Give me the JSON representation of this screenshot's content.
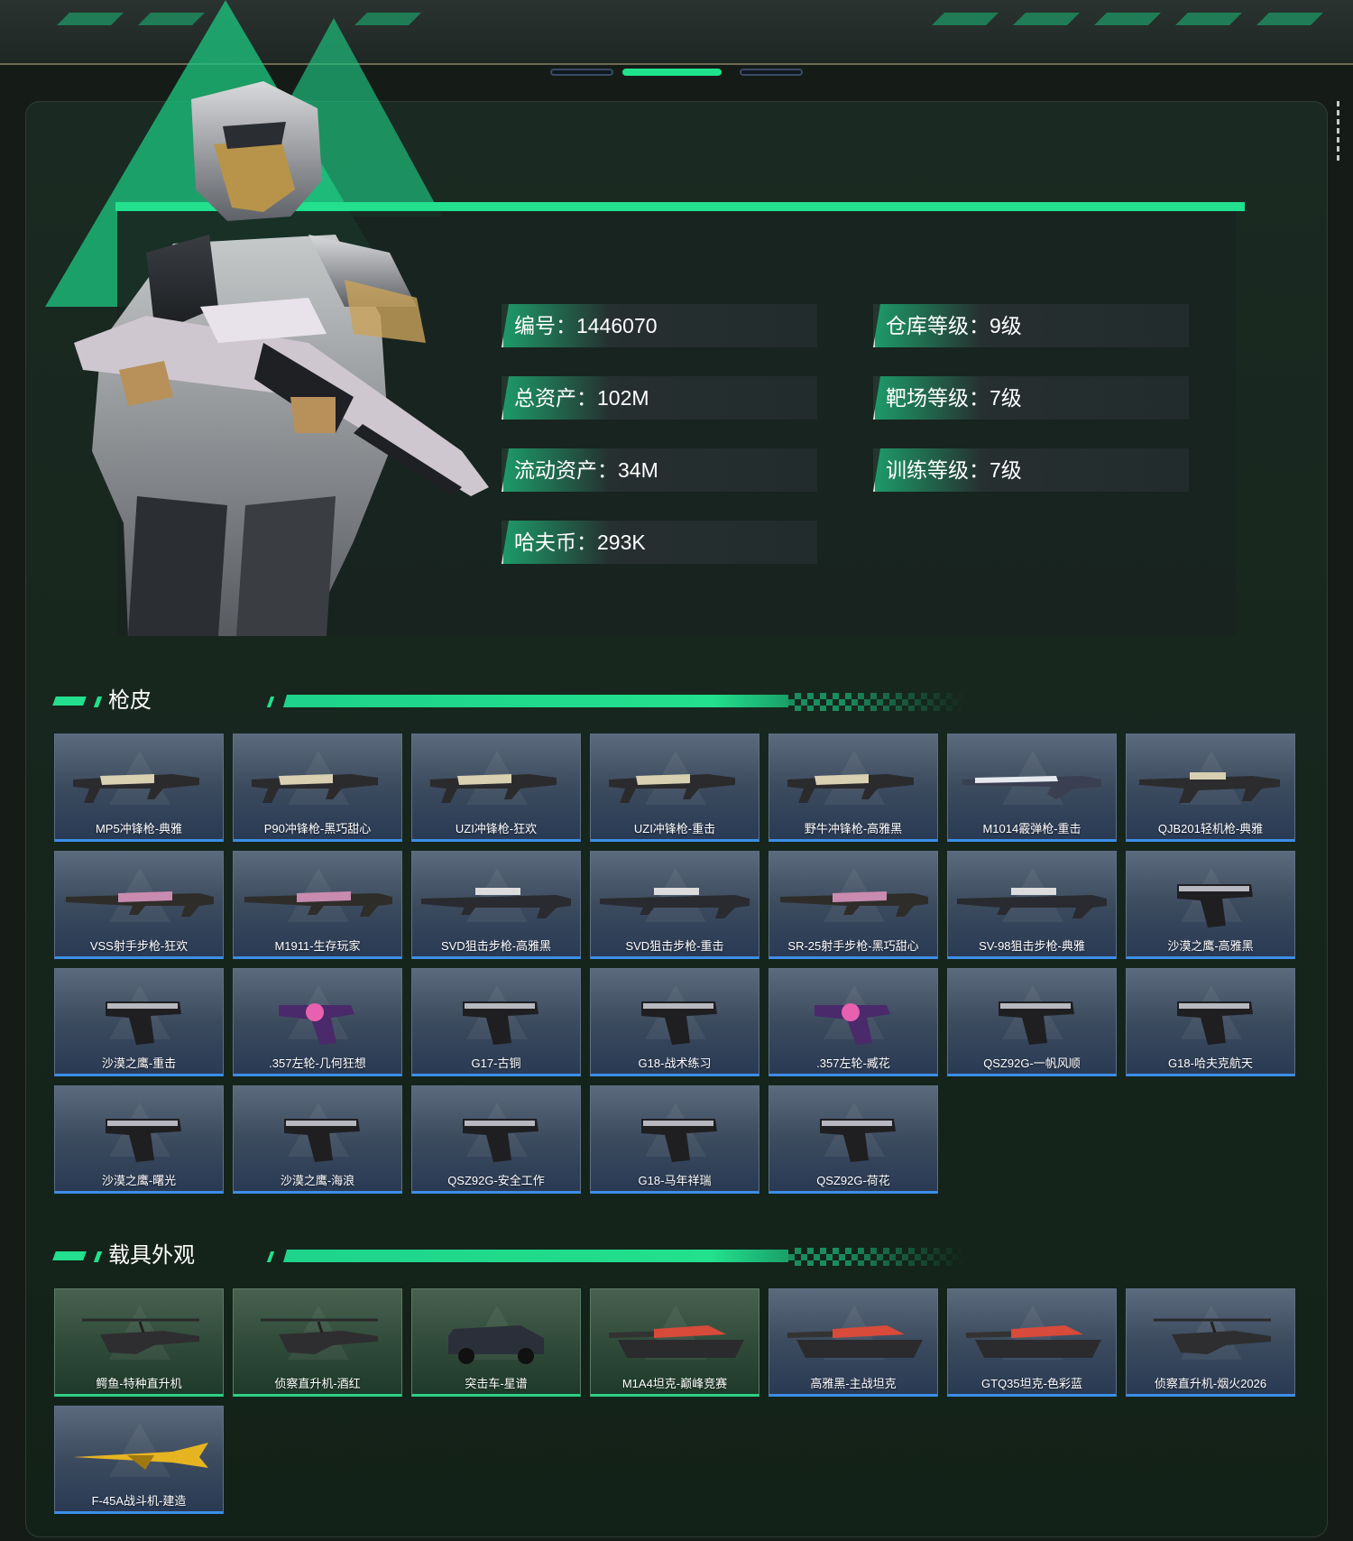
{
  "profile": {
    "stats_left": [
      {
        "label": "编号：1446070"
      },
      {
        "label": "总资产：102M"
      },
      {
        "label": "流动资产：34M"
      },
      {
        "label": "哈夫币：293K"
      }
    ],
    "stats_right": [
      {
        "label": "仓库等级：9级"
      },
      {
        "label": "靶场等级：7级"
      },
      {
        "label": "训练等级：7级"
      }
    ]
  },
  "sections": {
    "skins_title": "枪皮",
    "vehicles_title": "载具外观"
  },
  "skins": [
    {
      "name": "MP5冲锋枪-典雅",
      "icon": "smg-icon"
    },
    {
      "name": "P90冲锋枪-黑巧甜心",
      "icon": "smg-icon"
    },
    {
      "name": "UZI冲锋枪-狂欢",
      "icon": "smg-icon"
    },
    {
      "name": "UZI冲锋枪-重击",
      "icon": "smg-icon"
    },
    {
      "name": "野牛冲锋枪-高雅黑",
      "icon": "smg-icon"
    },
    {
      "name": "M1014霰弹枪-重击",
      "icon": "shotgun-icon"
    },
    {
      "name": "QJB201轻机枪-典雅",
      "icon": "lmg-icon"
    },
    {
      "name": "VSS射手步枪-狂欢",
      "icon": "rifle-icon"
    },
    {
      "name": "M1911-生存玩家",
      "icon": "rifle-icon"
    },
    {
      "name": "SVD狙击步枪-高雅黑",
      "icon": "sniper-icon"
    },
    {
      "name": "SVD狙击步枪-重击",
      "icon": "sniper-icon"
    },
    {
      "name": "SR-25射手步枪-黑巧甜心",
      "icon": "rifle-icon"
    },
    {
      "name": "SV-98狙击步枪-典雅",
      "icon": "sniper-icon"
    },
    {
      "name": "沙漠之鹰-高雅黑",
      "icon": "pistol-icon"
    },
    {
      "name": "沙漠之鹰-重击",
      "icon": "pistol-icon"
    },
    {
      "name": ".357左轮-几何狂想",
      "icon": "revolver-icon"
    },
    {
      "name": "G17-古铜",
      "icon": "pistol-icon"
    },
    {
      "name": "G18-战术练习",
      "icon": "pistol-icon"
    },
    {
      "name": ".357左轮-臧花",
      "icon": "revolver-icon"
    },
    {
      "name": "QSZ92G-一帆风顺",
      "icon": "pistol-icon"
    },
    {
      "name": "G18-哈夫克航天",
      "icon": "pistol-icon"
    },
    {
      "name": "沙漠之鹰-曙光",
      "icon": "pistol-icon"
    },
    {
      "name": "沙漠之鹰-海浪",
      "icon": "pistol-icon"
    },
    {
      "name": "QSZ92G-安全工作",
      "icon": "pistol-icon"
    },
    {
      "name": "G18-马年祥瑞",
      "icon": "pistol-icon"
    },
    {
      "name": "QSZ92G-荷花",
      "icon": "pistol-icon"
    }
  ],
  "vehicles": [
    {
      "name": "鳄鱼-特种直升机",
      "icon": "helicopter-icon",
      "tint": "green"
    },
    {
      "name": "侦察直升机-酒红",
      "icon": "helicopter-icon",
      "tint": "green"
    },
    {
      "name": "突击车-星谱",
      "icon": "armored-car-icon",
      "tint": "green"
    },
    {
      "name": "M1A4坦克-巅峰竞赛",
      "icon": "tank-icon",
      "tint": "green"
    },
    {
      "name": "高雅黑-主战坦克",
      "icon": "tank-icon",
      "tint": "blue"
    },
    {
      "name": "GTQ35坦克-色彩蓝",
      "icon": "tank-icon",
      "tint": "blue"
    },
    {
      "name": "侦察直升机-烟火2026",
      "icon": "helicopter-icon",
      "tint": "blue"
    },
    {
      "name": "F-45A战斗机-建造",
      "icon": "jet-icon",
      "tint": "blue"
    }
  ],
  "colors": {
    "accent": "#22e08d",
    "card_border_blue": "#3b8ee8",
    "card_border_green": "#2ecf86"
  }
}
